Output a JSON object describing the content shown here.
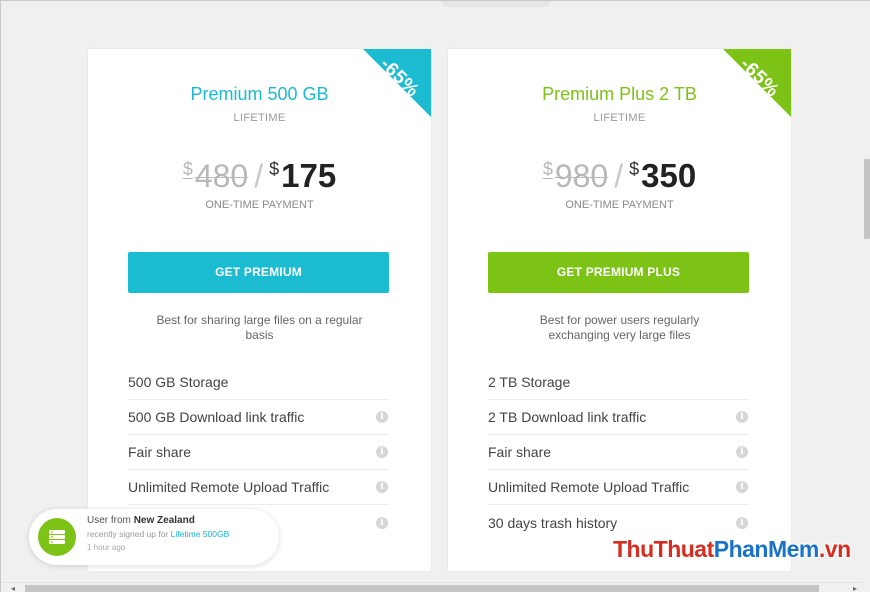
{
  "plans": [
    {
      "ribbon": "-65%",
      "title": "Premium 500 GB",
      "period": "LIFETIME",
      "old_currency": "$",
      "old_price": "480",
      "separator": "/",
      "new_currency": "$",
      "new_price": "175",
      "payment_note": "ONE-TIME PAYMENT",
      "cta": "GET PREMIUM",
      "description": "Best for sharing large files on a regular basis",
      "features": [
        {
          "label": "500 GB Storage",
          "info": false
        },
        {
          "label": "500 GB Download link traffic",
          "info": true
        },
        {
          "label": "Fair share",
          "info": true
        },
        {
          "label": "Unlimited Remote Upload Traffic",
          "info": true
        },
        {
          "label": "",
          "info": true
        }
      ]
    },
    {
      "ribbon": "-65%",
      "title": "Premium Plus 2 TB",
      "period": "LIFETIME",
      "old_currency": "$",
      "old_price": "980",
      "separator": "/",
      "new_currency": "$",
      "new_price": "350",
      "payment_note": "ONE-TIME PAYMENT",
      "cta": "GET PREMIUM PLUS",
      "description": "Best for power users regularly exchanging very large files",
      "features": [
        {
          "label": "2 TB Storage",
          "info": false
        },
        {
          "label": "2 TB Download link traffic",
          "info": true
        },
        {
          "label": "Fair share",
          "info": true
        },
        {
          "label": "Unlimited Remote Upload Traffic",
          "info": true
        },
        {
          "label": "30 days trash history",
          "info": true
        }
      ]
    }
  ],
  "colors": {
    "premium_accent": "#1bbbd1",
    "premium_plus_accent": "#7dc315"
  },
  "notification": {
    "prefix": "User from",
    "location": "New Zealand",
    "action": "recently signed up for",
    "plan_link": "Lifetime 500GB",
    "time": "1 hour ago",
    "icon": "server-icon"
  },
  "watermark": {
    "part1": "ThuThuat",
    "part2": "PhanMem",
    "part3": ".vn"
  },
  "info_glyph": "i",
  "scroll_left": "◂",
  "scroll_right": "▸"
}
